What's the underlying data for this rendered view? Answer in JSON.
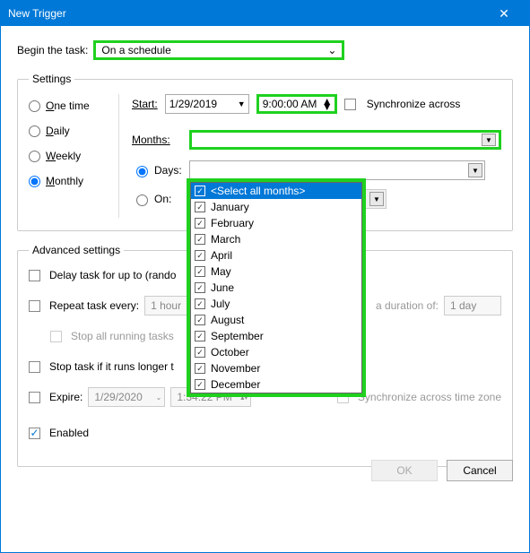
{
  "window": {
    "title": "New Trigger",
    "close": "✕"
  },
  "begin": {
    "label": "Begin the task:",
    "value": "On a schedule",
    "arrow": "⌄"
  },
  "settings": {
    "legend": "Settings",
    "freq": {
      "one": "One time",
      "daily": "Daily",
      "weekly": "Weekly",
      "monthly": "Monthly"
    },
    "start_label": "Start:",
    "start_date": "1/29/2019",
    "start_time": "9:00:00 AM",
    "sync": "Synchronize across",
    "months_label": "Months:",
    "days_label": "Days:",
    "on_label": "On:",
    "dd_arrow": "▼"
  },
  "months_list": {
    "select_all": "<Select all months>",
    "items": [
      "January",
      "February",
      "March",
      "April",
      "May",
      "June",
      "July",
      "August",
      "September",
      "October",
      "November",
      "December"
    ]
  },
  "adv": {
    "legend": "Advanced settings",
    "delay": "Delay task for up to (rando",
    "repeat": "Repeat task every:",
    "repeat_val": "1 hour",
    "duration_lbl": "a duration of:",
    "duration_val": "1 day",
    "stop_running": "Stop all running tasks",
    "stop_longer": "Stop task if it runs longer t",
    "expire": "Expire:",
    "expire_date": "1/29/2020",
    "expire_time": "1:34:22 PM",
    "sync_tz": "Synchronize across time zone",
    "enabled": "Enabled"
  },
  "buttons": {
    "ok": "OK",
    "cancel": "Cancel"
  },
  "check": "✓"
}
